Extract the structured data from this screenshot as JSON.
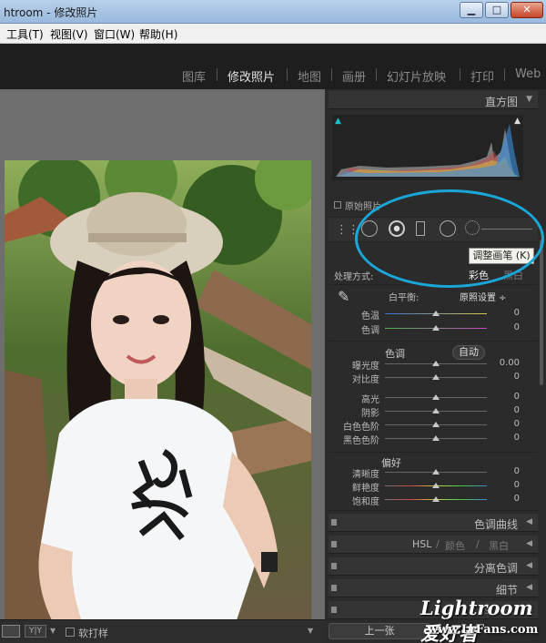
{
  "titlebar": {
    "title": "htroom - 修改照片"
  },
  "window_controls": {
    "minimize": "▁",
    "maximize": "□",
    "close": "✕"
  },
  "menu": [
    {
      "label": "工具(T)"
    },
    {
      "label": "视图(V)"
    },
    {
      "label": "窗口(W)"
    },
    {
      "label": "帮助(H)"
    }
  ],
  "modules": [
    {
      "label": "图库"
    },
    {
      "label": "修改照片",
      "active": true
    },
    {
      "label": "地图"
    },
    {
      "label": "画册"
    },
    {
      "label": "幻灯片放映"
    },
    {
      "label": "打印"
    },
    {
      "label": "Web"
    }
  ],
  "histogram": {
    "title": "直方图",
    "original_photo_label": "原始照片"
  },
  "tooltip": {
    "text": "调整画笔 (K)"
  },
  "basic": {
    "treatment_label": "处理方式:",
    "treatment_color": "彩色",
    "treatment_bw": "黑白",
    "wb_label": "白平衡:",
    "wb_value": "原照设置 ÷",
    "tone_label": "色调",
    "auto_label": "自动",
    "presence_label": "偏好",
    "sliders": [
      {
        "label": "色温",
        "value": "0",
        "pos": 0.5
      },
      {
        "label": "色调",
        "value": "0",
        "pos": 0.5
      },
      {
        "label": "曝光度",
        "value": "0.00",
        "pos": 0.5
      },
      {
        "label": "对比度",
        "value": "0",
        "pos": 0.5
      },
      {
        "label": "高光",
        "value": "0",
        "pos": 0.5
      },
      {
        "label": "阴影",
        "value": "0",
        "pos": 0.5
      },
      {
        "label": "白色色阶",
        "value": "0",
        "pos": 0.5
      },
      {
        "label": "黑色色阶",
        "value": "0",
        "pos": 0.5
      },
      {
        "label": "清晰度",
        "value": "0",
        "pos": 0.5
      },
      {
        "label": "鲜艳度",
        "value": "0",
        "pos": 0.5
      },
      {
        "label": "饱和度",
        "value": "0",
        "pos": 0.5
      }
    ]
  },
  "panels": {
    "tone_curve": "色调曲线",
    "hsl": "HSL",
    "hsl_color": "颜色",
    "hsl_bw": "黑白",
    "split_toning": "分离色调",
    "detail": "细节",
    "hidden_panel": "...s... /..."
  },
  "bottom": {
    "view_yy": "Y|Y",
    "soft_proof": "软打样",
    "previous": "上一张"
  },
  "watermark": {
    "logo": "Lightroom 爱好者",
    "url": "www.LrFans.com"
  },
  "colors": {
    "accent_ellipse": "#1aa7d8",
    "panel_bg": "#2b2b2b",
    "canvas_bg": "#6e6e6e"
  }
}
